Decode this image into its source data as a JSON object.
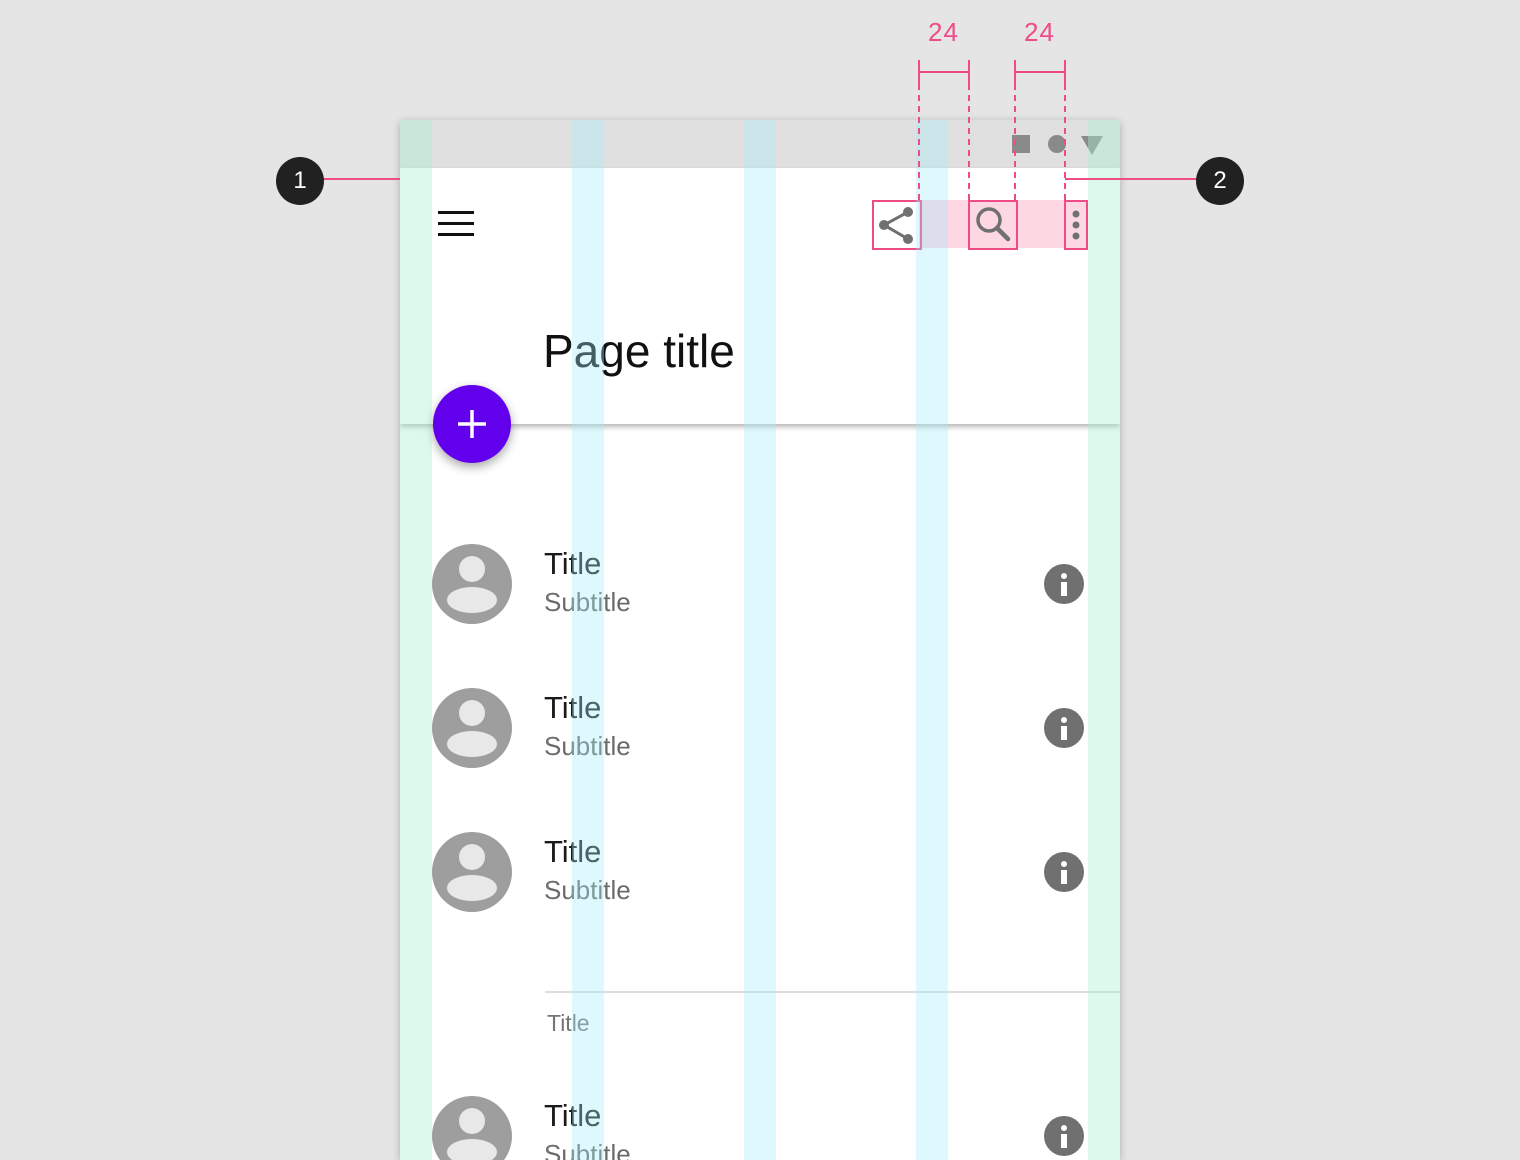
{
  "spec": {
    "callouts": [
      "1",
      "2"
    ],
    "measurements": [
      "24",
      "24"
    ],
    "accent_color": "#ef4b87"
  },
  "status_bar": {
    "icons": [
      "square-icon",
      "circle-icon",
      "triangle-icon"
    ]
  },
  "app_bar": {
    "navigation_icon": "menu-icon",
    "title": "Page title",
    "actions": [
      "share-icon",
      "search-icon",
      "more-vert-icon"
    ]
  },
  "fab": {
    "icon": "plus-icon",
    "color": "#6200ee"
  },
  "list": {
    "items": [
      {
        "title": "Title",
        "subtitle": "Subtitle",
        "trailing_icon": "info-icon"
      },
      {
        "title": "Title",
        "subtitle": "Subtitle",
        "trailing_icon": "info-icon"
      },
      {
        "title": "Title",
        "subtitle": "Subtitle",
        "trailing_icon": "info-icon"
      }
    ],
    "section": {
      "subheader": "Title",
      "items": [
        {
          "title": "Title",
          "subtitle": "Subtitle",
          "trailing_icon": "info-icon"
        }
      ]
    }
  }
}
